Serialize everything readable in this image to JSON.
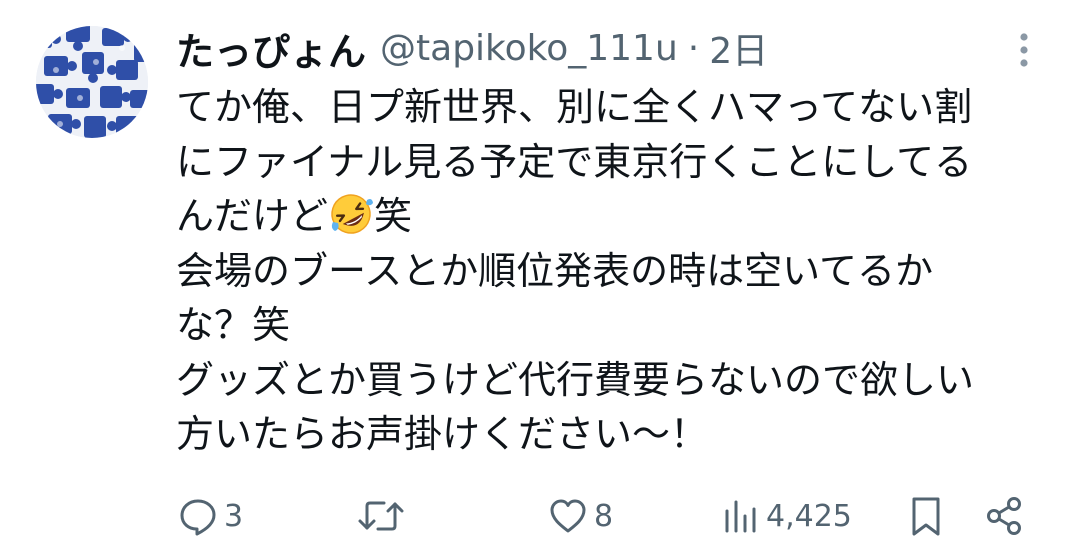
{
  "tweet": {
    "author": {
      "display_name": "たっぴょん",
      "handle": "@tapikoko_111u",
      "separator": "·",
      "time": "2日"
    },
    "body_lines": [
      "てか俺、日プ新世界、別に全くハマってない割",
      "にファイナル見る予定で東京行くことにしてる",
      "んだけど",
      "会場のブースとか順位発表の時は空いてるか",
      "な？笑",
      "グッズとか買うけど代行費要らないので欲しい",
      "方いたらお声掛けください〜！"
    ],
    "line3_suffix": "笑",
    "emoji": "rolling-on-the-floor-laughing",
    "actions": {
      "reply_count": "3",
      "repost_count": "",
      "like_count": "8",
      "view_count": "4,425"
    },
    "icons": [
      "more-vertical-icon",
      "reply-icon",
      "repost-icon",
      "like-icon",
      "views-icon",
      "bookmark-icon",
      "share-icon"
    ],
    "colors": {
      "text": "#0f1419",
      "secondary": "#536471",
      "avatar_puzzle": "#2f4fa8"
    }
  }
}
